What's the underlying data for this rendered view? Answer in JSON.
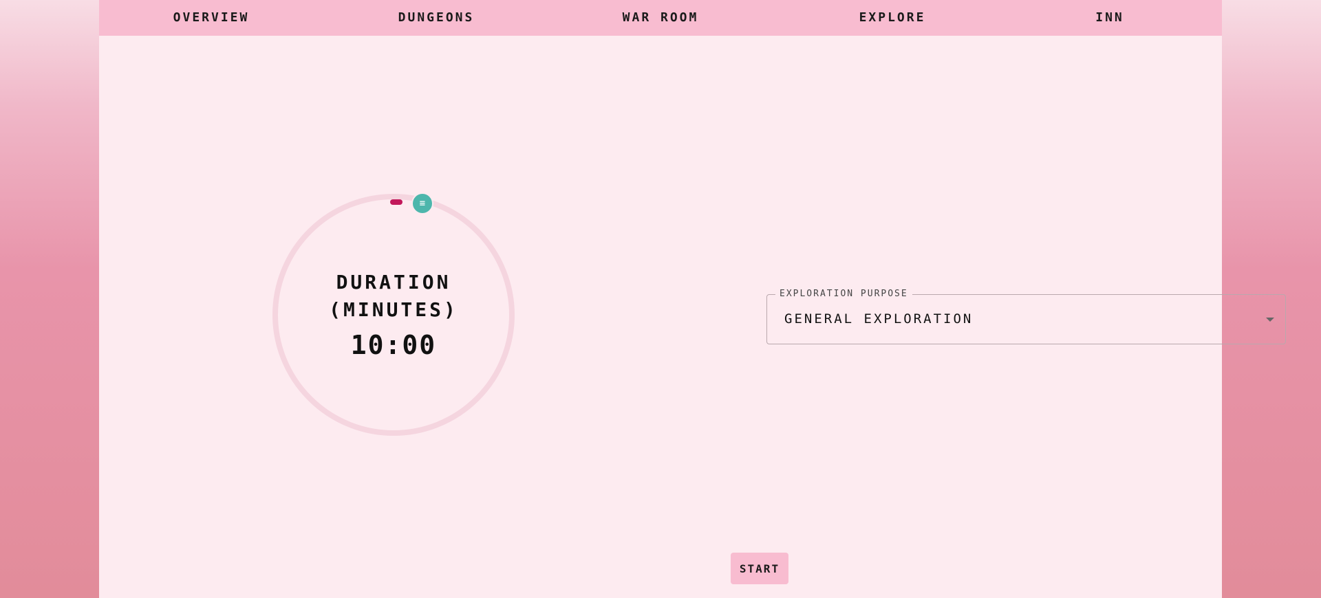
{
  "nav": {
    "items": [
      {
        "label": "OVERVIEW"
      },
      {
        "label": "DUNGEONS"
      },
      {
        "label": "WAR ROOM"
      },
      {
        "label": "EXPLORE"
      },
      {
        "label": "INN"
      }
    ]
  },
  "timer": {
    "label_line1": "DURATION",
    "label_line2": "(MINUTES)",
    "value": "10:00",
    "handle_icon": "drag-handle-icon",
    "handle_glyph": "≡"
  },
  "exploration": {
    "legend": "EXPLORATION PURPOSE",
    "selected": "GENERAL EXPLORATION"
  },
  "actions": {
    "start_label": "START"
  },
  "colors": {
    "nav_bg": "#f8bcd0",
    "panel_bg": "#fdebf0",
    "ring": "#f5d5df",
    "progress": "#c2185b",
    "handle": "#4db6ac"
  }
}
